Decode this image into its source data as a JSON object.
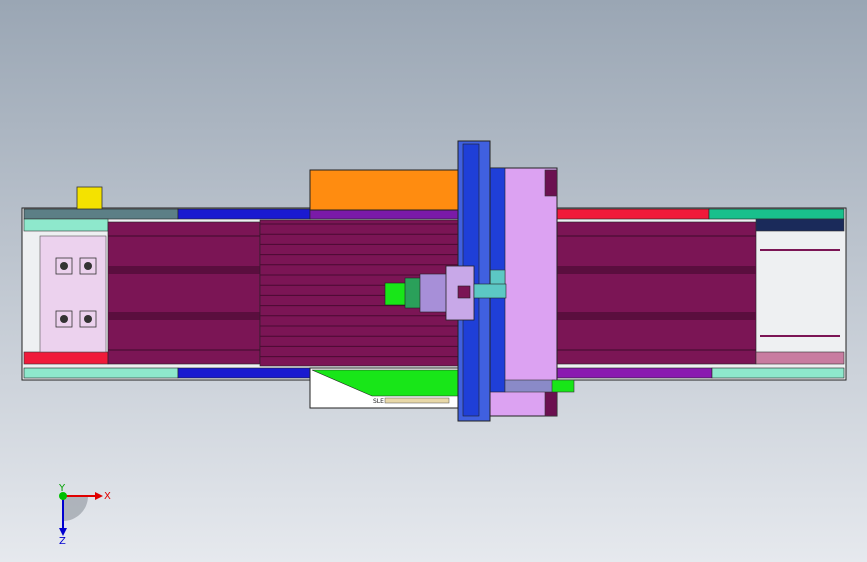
{
  "viewport": {
    "background_top": "#9aa6b4",
    "background_bottom": "#e6e9ee"
  },
  "model": {
    "part_label": "SLE",
    "colors": {
      "bed": "#7b1555",
      "bed_dark": "#5a0e3e",
      "crossbeam_blue": "#1f3fd8",
      "gantry_violet": "#dca2f2",
      "head_violet": "#a78fd8",
      "orange_panel": "#ff8c10",
      "green_panel": "#18e618",
      "yellow_block": "#f4e200",
      "red_rail": "#f01a3a",
      "cyan_rail": "#8ee8cc",
      "teal": "#5cc8c4"
    }
  },
  "triad": {
    "x_label": "X",
    "y_label": "Y",
    "z_label": "Z",
    "x_color": "#e00000",
    "y_color": "#00b000",
    "z_color": "#0000d0"
  }
}
